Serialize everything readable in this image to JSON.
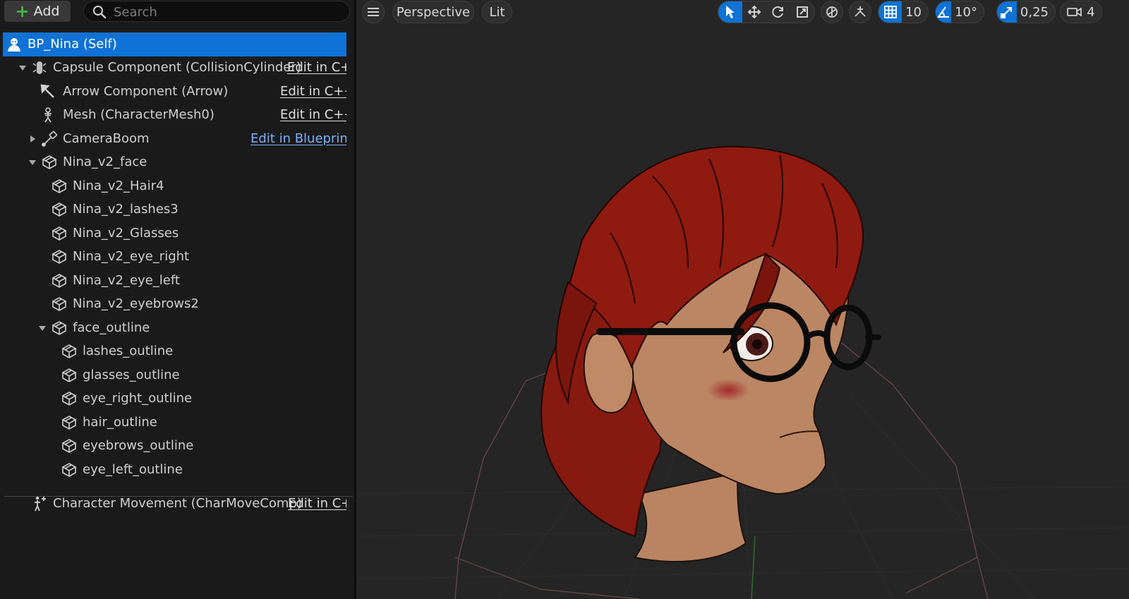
{
  "toolbar": {
    "add_label": "Add",
    "search_placeholder": "Search"
  },
  "tree": [
    {
      "label": "BP_Nina (Self)",
      "icon": "character-icon",
      "selected": true
    },
    {
      "label": "Capsule Component (CollisionCylinder)",
      "icon": "capsule-icon",
      "expander": "expanded",
      "action": "Edit in C++"
    },
    {
      "label": "Arrow Component (Arrow)",
      "icon": "arrow-icon",
      "action": "Edit in C++"
    },
    {
      "label": "Mesh (CharacterMesh0)",
      "icon": "skeleton-icon",
      "action": "Edit in C++"
    },
    {
      "label": "CameraBoom",
      "icon": "camera-boom-icon",
      "expander": "collapsed",
      "action": "Edit in Blueprint"
    },
    {
      "label": "Nina_v2_face",
      "icon": "static-mesh-icon",
      "expander": "expanded"
    },
    {
      "label": "Nina_v2_Hair4",
      "icon": "static-mesh-icon"
    },
    {
      "label": "Nina_v2_lashes3",
      "icon": "static-mesh-icon"
    },
    {
      "label": "Nina_v2_Glasses",
      "icon": "static-mesh-icon"
    },
    {
      "label": "Nina_v2_eye_right",
      "icon": "static-mesh-icon"
    },
    {
      "label": "Nina_v2_eye_left",
      "icon": "static-mesh-icon"
    },
    {
      "label": "Nina_v2_eyebrows2",
      "icon": "static-mesh-icon"
    },
    {
      "label": "face_outline",
      "icon": "static-mesh-icon",
      "expander": "expanded"
    },
    {
      "label": "lashes_outline",
      "icon": "static-mesh-icon"
    },
    {
      "label": "glasses_outline",
      "icon": "static-mesh-icon"
    },
    {
      "label": "eye_right_outline",
      "icon": "static-mesh-icon"
    },
    {
      "label": "hair_outline",
      "icon": "static-mesh-icon"
    },
    {
      "label": "eyebrows_outline",
      "icon": "static-mesh-icon"
    },
    {
      "label": "eye_left_outline",
      "icon": "static-mesh-icon"
    },
    {
      "label": "Character Movement (CharMoveComp)",
      "icon": "movement-icon",
      "action": "Edit in C++"
    }
  ],
  "viewport": {
    "menu_icon": "hamburger-icon",
    "perspective_label": "Perspective",
    "lit_label": "Lit",
    "grid_snap_value": "10",
    "rotation_snap_value": "10°",
    "scale_snap_value": "0,25",
    "camera_speed_value": "4"
  },
  "colors": {
    "selection": "#0f72d6",
    "blueprint_link": "#7fb0ff",
    "hair": "#8f1a10",
    "skin": "#bb8663"
  }
}
